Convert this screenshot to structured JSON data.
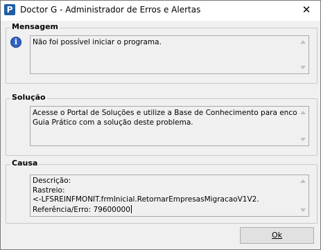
{
  "window": {
    "title": "Doctor G - Administrador de Erros e Alertas",
    "app_icon_letter": "P",
    "close_glyph": "✕"
  },
  "mensagem": {
    "title": "Mensagem",
    "icon": "info-icon",
    "text": "Não foi possível iniciar o programa."
  },
  "solucao": {
    "title": "Solução",
    "lines": [
      "Acesse o Portal de Soluções e utilize a Base de Conhecimento para encontrar o",
      "Guia Prático com a solução deste problema."
    ]
  },
  "causa": {
    "title": "Causa",
    "lines": [
      "Descrição:",
      "Rastreio:",
      "<-LFSREINFMONIT.frmInicial.RetornarEmpresasMigracaoV1V2.",
      "Referência/Erro: 79600000"
    ]
  },
  "ok_button": {
    "label": "Ok"
  }
}
